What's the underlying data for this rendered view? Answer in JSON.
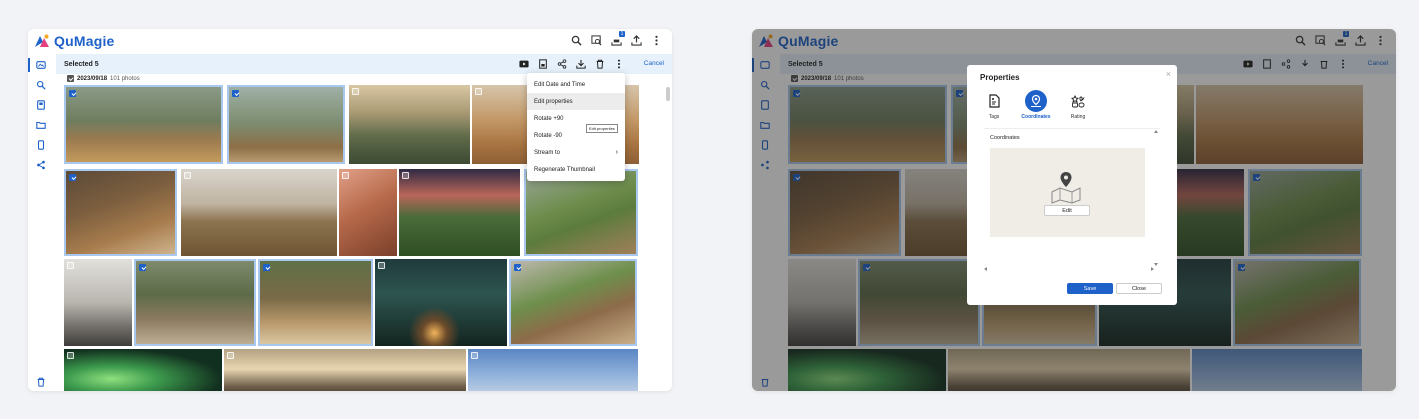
{
  "app": {
    "name": "QuMagie",
    "brand_color": "#1d61c9",
    "notification_count": "1",
    "top_icons": [
      "search-icon",
      "image-search-icon",
      "upload-queue-icon",
      "upload-icon",
      "more-vertical-icon"
    ]
  },
  "sidebar": {
    "items": [
      "photos-icon",
      "search-icon",
      "albums-icon",
      "folder-icon",
      "device-icon",
      "share-icon"
    ],
    "bottom": "trash-icon"
  },
  "selection": {
    "label": "Selected 5",
    "cancel": "Cancel",
    "actions": [
      "slideshow-icon",
      "properties-icon",
      "share-icon",
      "download-icon",
      "delete-icon",
      "more-vertical-icon"
    ]
  },
  "group": {
    "date": "2023/09/18",
    "count": "101 photos"
  },
  "context_menu": {
    "items": [
      {
        "label": "Edit Date and Time"
      },
      {
        "label": "Edit properties"
      },
      {
        "label": "Rotate +90"
      },
      {
        "label": "Rotate -90"
      },
      {
        "label": "Stream to"
      },
      {
        "label": "Regenerate Thumbnail"
      }
    ],
    "tooltip": "Edit properties"
  },
  "dialog": {
    "title": "Properties",
    "tabs": [
      {
        "label": "Tags",
        "icon": "tag-document-icon"
      },
      {
        "label": "Coordinates",
        "icon": "map-pin-icon"
      },
      {
        "label": "Rating",
        "icon": "rating-icon"
      }
    ],
    "section_label": "Coordinates",
    "edit_label": "Edit",
    "save_label": "Save",
    "close_label": "Close"
  }
}
